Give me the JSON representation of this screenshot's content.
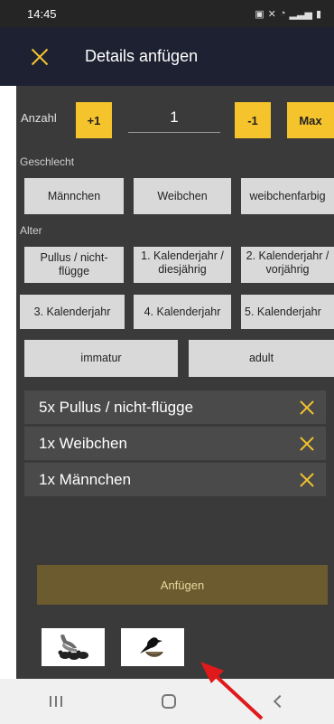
{
  "status_bar": {
    "time": "14:45"
  },
  "header": {
    "title": "Details anfügen"
  },
  "count": {
    "label": "Anzahl",
    "plus": "+1",
    "value": "1",
    "minus": "-1",
    "max": "Max"
  },
  "sex": {
    "label": "Geschlecht",
    "options": [
      "Männchen",
      "Weibchen",
      "weibchenfarbig"
    ]
  },
  "age": {
    "label": "Alter",
    "options_row1": [
      "Pullus / nicht-flügge",
      "1. Kalenderjahr / diesjährig",
      "2. Kalenderjahr / vorjährig"
    ],
    "options_row2": [
      "3. Kalenderjahr",
      "4. Kalenderjahr",
      "5. Kalenderjahr"
    ],
    "options_row3": [
      "immatur",
      "adult"
    ]
  },
  "selected_items": [
    "5x Pullus / nicht-flügge",
    "1x Weibchen",
    "1x Männchen"
  ],
  "submit_label": "Anfügen",
  "image_buttons": {
    "left_icon": "duck-family-icon",
    "right_icon": "bird-nest-icon"
  },
  "colors": {
    "accent": "#f5c32c",
    "app_bar": "#1e2132",
    "background": "#3a3a3a",
    "submit": "#6b5b2e",
    "arrow": "#e0191b"
  }
}
